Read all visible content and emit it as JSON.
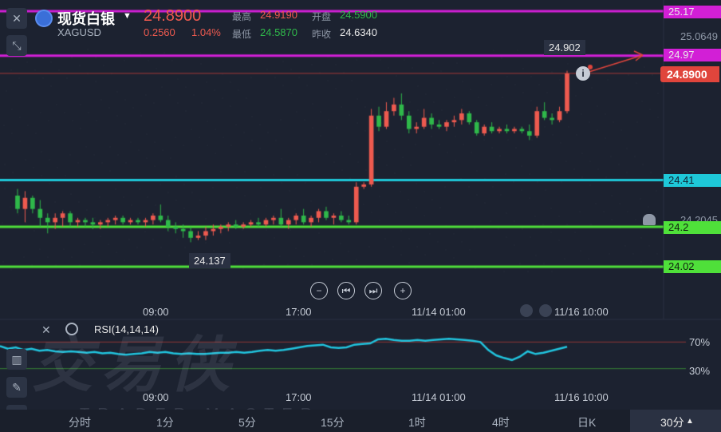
{
  "header": {
    "title": "现货白银",
    "symbol": "XAGUSD",
    "price": "24.8900",
    "change": "0.2560",
    "change_pct": "1.04%",
    "high_label": "最高",
    "high_value": "24.9190",
    "open_label": "开盘",
    "open_value": "24.5900",
    "low_label": "最低",
    "low_value": "24.5870",
    "prev_close_label": "昨收",
    "prev_close_value": "24.6340"
  },
  "price_axis": {
    "labels": [
      "25.17",
      "25.0649",
      "24.97",
      "24.8900",
      "24.41",
      "24.2",
      "24.02"
    ],
    "partial_label": "24.2045"
  },
  "annotations": {
    "peak_value": "24.902",
    "trough_value": "24.137"
  },
  "x_axis": {
    "labels": [
      "09:00",
      "17:00",
      "11/14 01:00",
      "11/16 10:00"
    ]
  },
  "rsi": {
    "label": "RSI(14,14,14)",
    "upper_level": "70%",
    "lower_level": "30%"
  },
  "timeframes": [
    "分时",
    "1分",
    "5分",
    "15分",
    "1时",
    "4时",
    "日K",
    "30分"
  ],
  "active_timeframe": "30分",
  "watermark": {
    "main": "交易侠",
    "sub": "TRADER MASTER"
  },
  "colors": {
    "up": "#ee5a4f",
    "down": "#2fb84a",
    "magenta_line": "#d21fd6",
    "cyan_line": "#1ec8d8",
    "green_line": "#4fe03a",
    "rsi_line": "#21c4de"
  },
  "chart_data": {
    "type": "candlestick",
    "y_range": [
      23.95,
      25.2
    ],
    "horizontal_levels": [
      25.17,
      24.97,
      24.41,
      24.2,
      24.02
    ],
    "last_price": 24.89,
    "candles": [
      {
        "o": 24.34,
        "h": 24.37,
        "l": 24.26,
        "c": 24.28
      },
      {
        "o": 24.28,
        "h": 24.36,
        "l": 24.22,
        "c": 24.33
      },
      {
        "o": 24.33,
        "h": 24.34,
        "l": 24.26,
        "c": 24.28
      },
      {
        "o": 24.28,
        "h": 24.32,
        "l": 24.2,
        "c": 24.24
      },
      {
        "o": 24.24,
        "h": 24.26,
        "l": 24.17,
        "c": 24.22
      },
      {
        "o": 24.22,
        "h": 24.26,
        "l": 24.19,
        "c": 24.24
      },
      {
        "o": 24.24,
        "h": 24.27,
        "l": 24.2,
        "c": 24.26
      },
      {
        "o": 24.26,
        "h": 24.27,
        "l": 24.2,
        "c": 24.22
      },
      {
        "o": 24.22,
        "h": 24.24,
        "l": 24.2,
        "c": 24.23
      },
      {
        "o": 24.23,
        "h": 24.24,
        "l": 24.2,
        "c": 24.22
      },
      {
        "o": 24.22,
        "h": 24.24,
        "l": 24.19,
        "c": 24.21
      },
      {
        "o": 24.21,
        "h": 24.23,
        "l": 24.19,
        "c": 24.22
      },
      {
        "o": 24.22,
        "h": 24.24,
        "l": 24.2,
        "c": 24.23
      },
      {
        "o": 24.23,
        "h": 24.25,
        "l": 24.21,
        "c": 24.24
      },
      {
        "o": 24.24,
        "h": 24.25,
        "l": 24.21,
        "c": 24.22
      },
      {
        "o": 24.22,
        "h": 24.24,
        "l": 24.21,
        "c": 24.23
      },
      {
        "o": 24.23,
        "h": 24.24,
        "l": 24.21,
        "c": 24.22
      },
      {
        "o": 24.22,
        "h": 24.24,
        "l": 24.2,
        "c": 24.23
      },
      {
        "o": 24.23,
        "h": 24.26,
        "l": 24.21,
        "c": 24.25
      },
      {
        "o": 24.25,
        "h": 24.3,
        "l": 24.22,
        "c": 24.23
      },
      {
        "o": 24.23,
        "h": 24.25,
        "l": 24.18,
        "c": 24.2
      },
      {
        "o": 24.2,
        "h": 24.22,
        "l": 24.17,
        "c": 24.19
      },
      {
        "o": 24.19,
        "h": 24.21,
        "l": 24.15,
        "c": 24.18
      },
      {
        "o": 24.18,
        "h": 24.2,
        "l": 24.13,
        "c": 24.15
      },
      {
        "o": 24.15,
        "h": 24.18,
        "l": 24.14,
        "c": 24.16
      },
      {
        "o": 24.16,
        "h": 24.2,
        "l": 24.14,
        "c": 24.18
      },
      {
        "o": 24.18,
        "h": 24.21,
        "l": 24.16,
        "c": 24.19
      },
      {
        "o": 24.19,
        "h": 24.21,
        "l": 24.17,
        "c": 24.2
      },
      {
        "o": 24.2,
        "h": 24.22,
        "l": 24.18,
        "c": 24.21
      },
      {
        "o": 24.21,
        "h": 24.23,
        "l": 24.19,
        "c": 24.2
      },
      {
        "o": 24.2,
        "h": 24.22,
        "l": 24.19,
        "c": 24.21
      },
      {
        "o": 24.21,
        "h": 24.23,
        "l": 24.2,
        "c": 24.22
      },
      {
        "o": 24.22,
        "h": 24.24,
        "l": 24.2,
        "c": 24.21
      },
      {
        "o": 24.21,
        "h": 24.24,
        "l": 24.2,
        "c": 24.23
      },
      {
        "o": 24.23,
        "h": 24.25,
        "l": 24.21,
        "c": 24.24
      },
      {
        "o": 24.24,
        "h": 24.28,
        "l": 24.2,
        "c": 24.21
      },
      {
        "o": 24.21,
        "h": 24.24,
        "l": 24.19,
        "c": 24.23
      },
      {
        "o": 24.23,
        "h": 24.26,
        "l": 24.21,
        "c": 24.25
      },
      {
        "o": 24.25,
        "h": 24.28,
        "l": 24.21,
        "c": 24.22
      },
      {
        "o": 24.22,
        "h": 24.25,
        "l": 24.2,
        "c": 24.24
      },
      {
        "o": 24.24,
        "h": 24.28,
        "l": 24.22,
        "c": 24.27
      },
      {
        "o": 24.27,
        "h": 24.29,
        "l": 24.23,
        "c": 24.24
      },
      {
        "o": 24.24,
        "h": 24.26,
        "l": 24.21,
        "c": 24.25
      },
      {
        "o": 24.25,
        "h": 24.27,
        "l": 24.22,
        "c": 24.23
      },
      {
        "o": 24.23,
        "h": 24.25,
        "l": 24.21,
        "c": 24.22
      },
      {
        "o": 24.22,
        "h": 24.4,
        "l": 24.21,
        "c": 24.38
      },
      {
        "o": 24.38,
        "h": 24.4,
        "l": 24.37,
        "c": 24.39
      },
      {
        "o": 24.39,
        "h": 24.73,
        "l": 24.38,
        "c": 24.7
      },
      {
        "o": 24.7,
        "h": 24.74,
        "l": 24.63,
        "c": 24.65
      },
      {
        "o": 24.65,
        "h": 24.76,
        "l": 24.64,
        "c": 24.72
      },
      {
        "o": 24.72,
        "h": 24.78,
        "l": 24.7,
        "c": 24.75
      },
      {
        "o": 24.75,
        "h": 24.8,
        "l": 24.68,
        "c": 24.7
      },
      {
        "o": 24.7,
        "h": 24.72,
        "l": 24.62,
        "c": 24.64
      },
      {
        "o": 24.64,
        "h": 24.67,
        "l": 24.62,
        "c": 24.65
      },
      {
        "o": 24.65,
        "h": 24.73,
        "l": 24.64,
        "c": 24.69
      },
      {
        "o": 24.69,
        "h": 24.71,
        "l": 24.64,
        "c": 24.66
      },
      {
        "o": 24.66,
        "h": 24.68,
        "l": 24.64,
        "c": 24.65
      },
      {
        "o": 24.65,
        "h": 24.68,
        "l": 24.63,
        "c": 24.67
      },
      {
        "o": 24.67,
        "h": 24.7,
        "l": 24.65,
        "c": 24.68
      },
      {
        "o": 24.68,
        "h": 24.73,
        "l": 24.66,
        "c": 24.71
      },
      {
        "o": 24.71,
        "h": 24.72,
        "l": 24.66,
        "c": 24.67
      },
      {
        "o": 24.67,
        "h": 24.68,
        "l": 24.61,
        "c": 24.62
      },
      {
        "o": 24.62,
        "h": 24.66,
        "l": 24.61,
        "c": 24.65
      },
      {
        "o": 24.65,
        "h": 24.67,
        "l": 24.62,
        "c": 24.63
      },
      {
        "o": 24.63,
        "h": 24.65,
        "l": 24.62,
        "c": 24.64
      },
      {
        "o": 24.64,
        "h": 24.66,
        "l": 24.62,
        "c": 24.63
      },
      {
        "o": 24.63,
        "h": 24.65,
        "l": 24.62,
        "c": 24.64
      },
      {
        "o": 24.64,
        "h": 24.65,
        "l": 24.62,
        "c": 24.63
      },
      {
        "o": 24.63,
        "h": 24.66,
        "l": 24.59,
        "c": 24.61
      },
      {
        "o": 24.61,
        "h": 24.74,
        "l": 24.6,
        "c": 24.72
      },
      {
        "o": 24.72,
        "h": 24.76,
        "l": 24.68,
        "c": 24.69
      },
      {
        "o": 24.69,
        "h": 24.71,
        "l": 24.66,
        "c": 24.68
      },
      {
        "o": 24.68,
        "h": 24.74,
        "l": 24.67,
        "c": 24.72
      },
      {
        "o": 24.72,
        "h": 24.902,
        "l": 24.71,
        "c": 24.89
      }
    ],
    "rsi_values": [
      64,
      60,
      62,
      58,
      60,
      57,
      58,
      56,
      55,
      56,
      55,
      54,
      55,
      53,
      54,
      52,
      51,
      52,
      53,
      55,
      54,
      55,
      53,
      52,
      53,
      52,
      52,
      53,
      54,
      54,
      55,
      54,
      55,
      57,
      58,
      57,
      58,
      60,
      62,
      64,
      65,
      66,
      62,
      61,
      62,
      66,
      67,
      68,
      74,
      75,
      73,
      72,
      72,
      73,
      72,
      73,
      74,
      75,
      74,
      73,
      72,
      70,
      58,
      50,
      46,
      43,
      48,
      56,
      52,
      54,
      57,
      60,
      63
    ],
    "rsi_levels": [
      70,
      30
    ]
  }
}
